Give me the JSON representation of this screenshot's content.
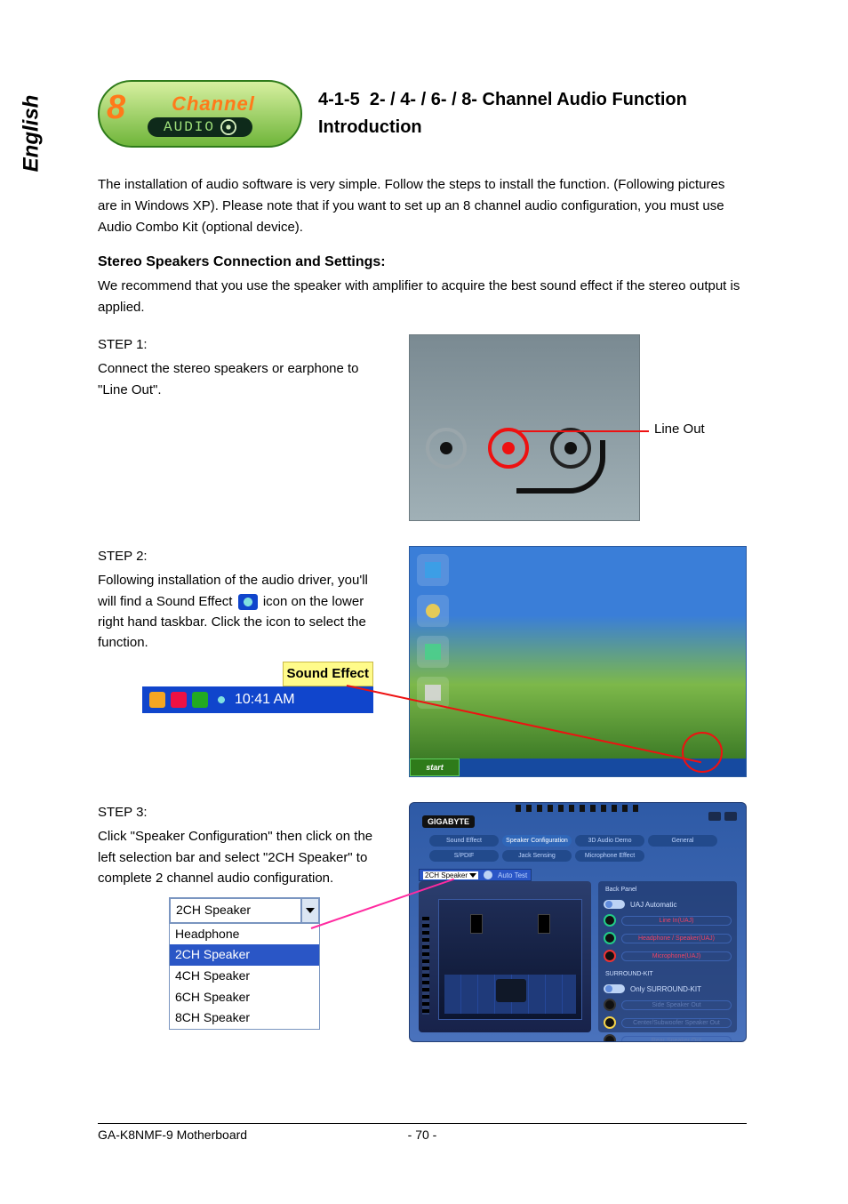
{
  "language_tab": "English",
  "logo": {
    "big_number": "8",
    "word": "Channel",
    "bar": "AUDIO"
  },
  "heading": {
    "number": "4-1-5",
    "title_l1": "2- / 4- / 6- / 8- Channel Audio Function",
    "title_l2": "Introduction"
  },
  "intro": "The installation of audio software is very simple. Follow the steps to install the function. (Following pictures are in Windows XP). Please note that if you want to set up an 8 channel audio configuration, you must use Audio Combo Kit (optional device).",
  "subheading": "Stereo Speakers Connection and Settings:",
  "subtext": "We recommend that you use the speaker with amplifier to acquire the best sound effect if the stereo output is applied.",
  "step1": {
    "label": "STEP 1:",
    "text": "Connect the stereo speakers or earphone to \"Line Out\".",
    "callout": "Line Out"
  },
  "step2": {
    "label": "STEP 2:",
    "text_a": "Following installation of the audio driver, you'll will find a Sound Effect ",
    "text_b": " icon on the lower right hand taskbar. Click the icon to select the function.",
    "tooltip": "Sound Effect",
    "clock": "10:41 AM",
    "start": "start"
  },
  "step3": {
    "label": "STEP 3:",
    "text": "Click \"Speaker Configuration\" then click on the left selection bar and select \"2CH Speaker\" to complete 2 channel audio configuration.",
    "dropdown": {
      "current": "2CH Speaker",
      "options": [
        "Headphone",
        "2CH Speaker",
        "4CH Speaker",
        "6CH Speaker",
        "8CH Speaker"
      ],
      "selected_index": 1
    },
    "panel": {
      "brand": "GIGABYTE",
      "tabs_row1": [
        "Sound Effect",
        "Speaker Configuration",
        "3D Audio Demo",
        "General"
      ],
      "tabs_row2": [
        "S/PDIF",
        "Jack Sensing",
        "Microphone Effect"
      ],
      "active_tab_index": 1,
      "selector_label": "2CH Speaker",
      "auto_test": "Auto Test",
      "back_panel": "Back Panel",
      "uaj": "UAJ Automatic",
      "jacks": [
        "Line In(UAJ)",
        "Headphone / Speaker(UAJ)",
        "Microphone(UAJ)"
      ],
      "surround_kit": "SURROUND-KIT",
      "only_kit": "Only SURROUND-KIT",
      "kit_jacks": [
        "Side Speaker Out",
        "Center/Subwoofer Speaker Out",
        "Rear Speaker Out"
      ]
    }
  },
  "footer": {
    "left": "GA-K8NMF-9 Motherboard",
    "center": "- 70 -"
  }
}
